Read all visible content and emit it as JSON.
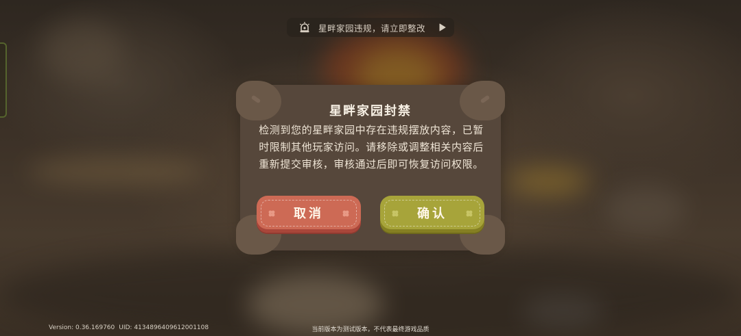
{
  "notice": {
    "icon": "alarm-icon",
    "text": "星畔家园违规，请立即整改",
    "arrow_icon": "play-icon"
  },
  "dialog": {
    "title": "星畔家园封禁",
    "message": "检测到您的星畔家园中存在违规摆放内容，已暂时限制其他玩家访问。请移除或调整相关内容后重新提交审核，审核通过后即可恢复访问权限。",
    "cancel_label": "取消",
    "confirm_label": "确认"
  },
  "footer": {
    "version": "Version: 0.36.169760",
    "uid": "UID: 4134896409612001108",
    "disclaimer": "当前版本为测试版本，不代表最终游戏品质"
  },
  "colors": {
    "dialog_bg": "#56473b",
    "cancel_button": "#cd6a55",
    "confirm_button": "#a7a43a"
  }
}
